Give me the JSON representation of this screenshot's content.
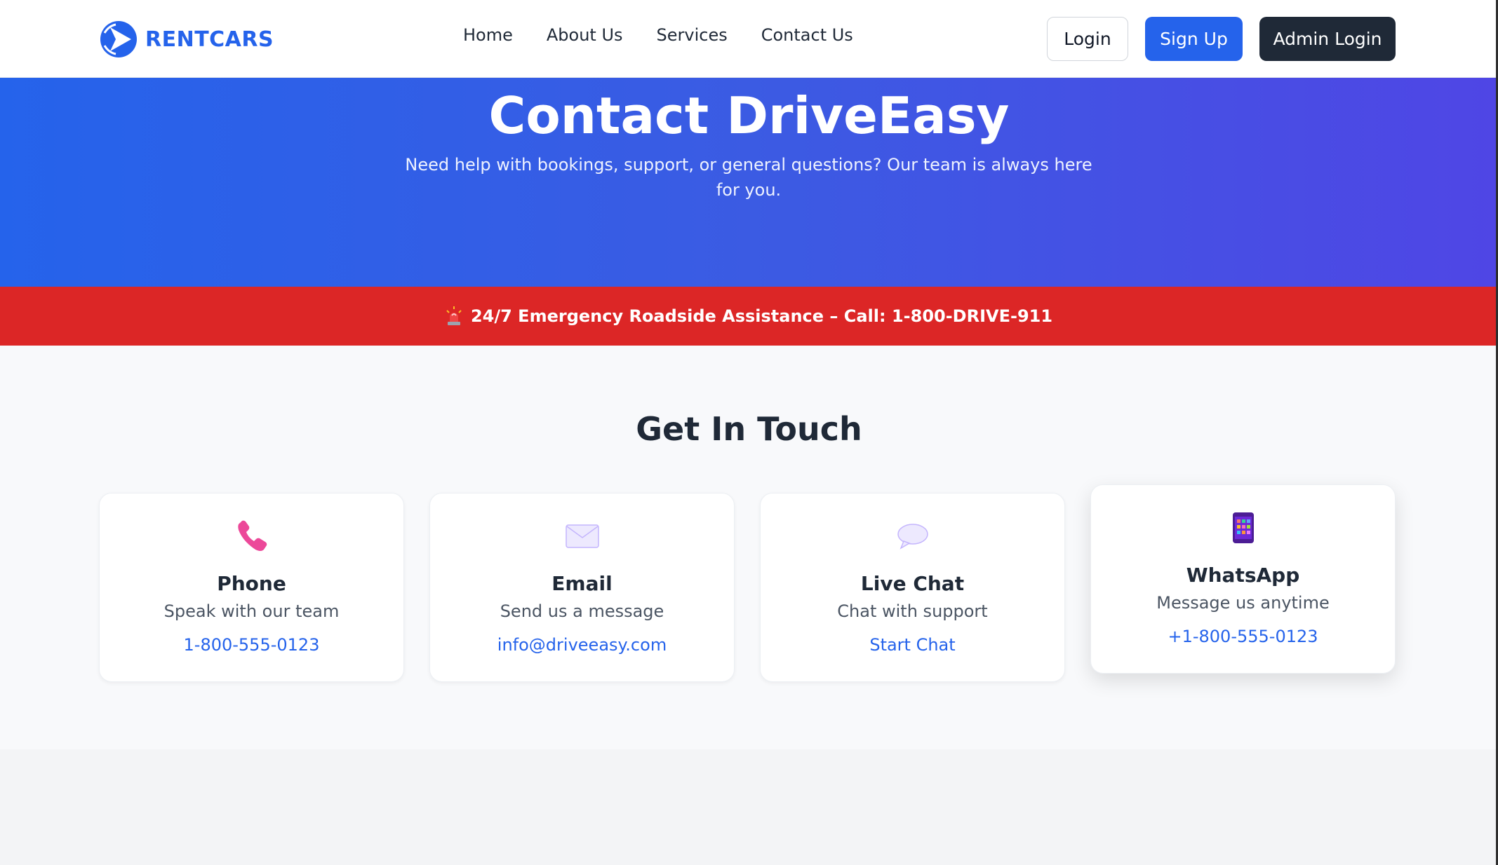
{
  "brand": {
    "name": "RENTCARS",
    "logo_icon": "play-logo-icon",
    "color": "#2563eb"
  },
  "nav": {
    "links": [
      {
        "label": "Home"
      },
      {
        "label": "About Us"
      },
      {
        "label": "Services"
      },
      {
        "label": "Contact Us"
      }
    ],
    "login_label": "Login",
    "signup_label": "Sign Up",
    "admin_label": "Admin Login"
  },
  "hero": {
    "title": "Contact DriveEasy",
    "subtitle": "Need help with bookings, support, or general questions? Our team is always here for you."
  },
  "emergency": {
    "icon": "siren-icon",
    "text": "24/7 Emergency Roadside Assistance – Call: 1-800-DRIVE-911",
    "color": "#dc2626"
  },
  "contact": {
    "title": "Get In Touch",
    "cards": [
      {
        "icon": "phone-icon",
        "title": "Phone",
        "desc": "Speak with our team",
        "link": "1-800-555-0123"
      },
      {
        "icon": "envelope-icon",
        "title": "Email",
        "desc": "Send us a message",
        "link": "info@driveeasy.com"
      },
      {
        "icon": "speech-bubble-icon",
        "title": "Live Chat",
        "desc": "Chat with support",
        "link": "Start Chat"
      },
      {
        "icon": "mobile-phone-icon",
        "title": "WhatsApp",
        "desc": "Message us anytime",
        "link": "+1-800-555-0123"
      }
    ]
  },
  "colors": {
    "primary": "#2563eb",
    "hero_gradient_start": "#2563eb",
    "hero_gradient_end": "#4f46e5",
    "dark": "#1f2937",
    "emergency": "#dc2626"
  }
}
